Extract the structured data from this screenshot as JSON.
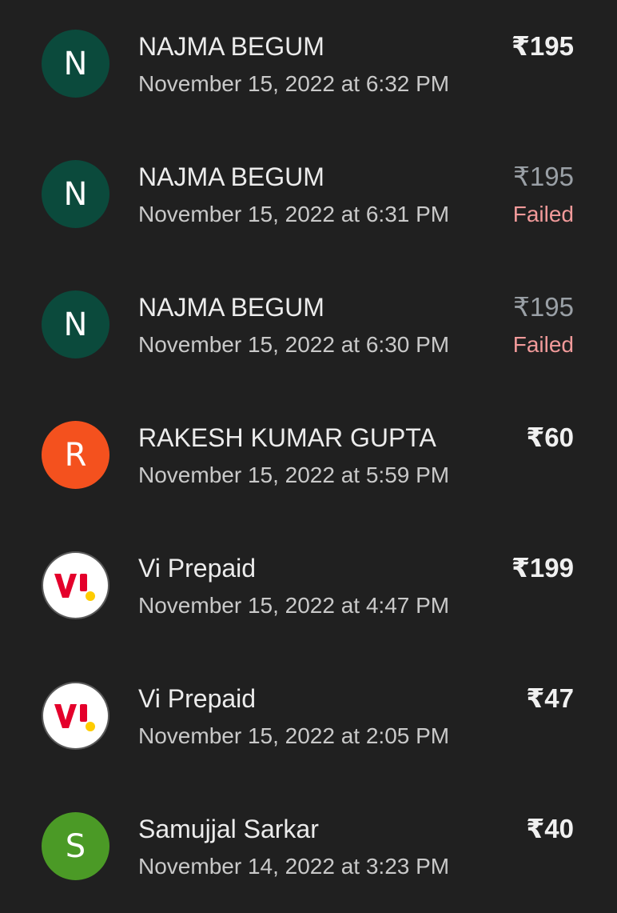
{
  "colors": {
    "background": "#202020",
    "failed": "#f19a9a",
    "vi_red": "#e4002b",
    "vi_yellow": "#fecc00"
  },
  "transactions": [
    {
      "avatar": {
        "type": "letter",
        "letter": "N",
        "color": "#0b4a3c"
      },
      "name": "NAJMA BEGUM",
      "datetime": "November 15, 2022 at 6:32 PM",
      "amount": "₹195",
      "status": ""
    },
    {
      "avatar": {
        "type": "letter",
        "letter": "N",
        "color": "#0b4a3c"
      },
      "name": "NAJMA BEGUM",
      "datetime": "November 15, 2022 at 6:31 PM",
      "amount": "₹195",
      "status": "Failed"
    },
    {
      "avatar": {
        "type": "letter",
        "letter": "N",
        "color": "#0b4a3c"
      },
      "name": "NAJMA BEGUM",
      "datetime": "November 15, 2022 at 6:30 PM",
      "amount": "₹195",
      "status": "Failed"
    },
    {
      "avatar": {
        "type": "letter",
        "letter": "R",
        "color": "#f4511e"
      },
      "name": "RAKESH KUMAR GUPTA",
      "datetime": "November 15, 2022 at 5:59 PM",
      "amount": "₹60",
      "status": ""
    },
    {
      "avatar": {
        "type": "logo",
        "icon": "vi-logo-icon",
        "letter": "Vi"
      },
      "name": "Vi Prepaid",
      "datetime": "November 15, 2022 at 4:47 PM",
      "amount": "₹199",
      "status": ""
    },
    {
      "avatar": {
        "type": "logo",
        "icon": "vi-logo-icon",
        "letter": "Vi"
      },
      "name": "Vi Prepaid",
      "datetime": "November 15, 2022 at 2:05 PM",
      "amount": "₹47",
      "status": ""
    },
    {
      "avatar": {
        "type": "letter",
        "letter": "S",
        "color": "#4b9a26"
      },
      "name": "Samujjal Sarkar",
      "datetime": "November 14, 2022 at 3:23 PM",
      "amount": "₹40",
      "status": ""
    }
  ]
}
